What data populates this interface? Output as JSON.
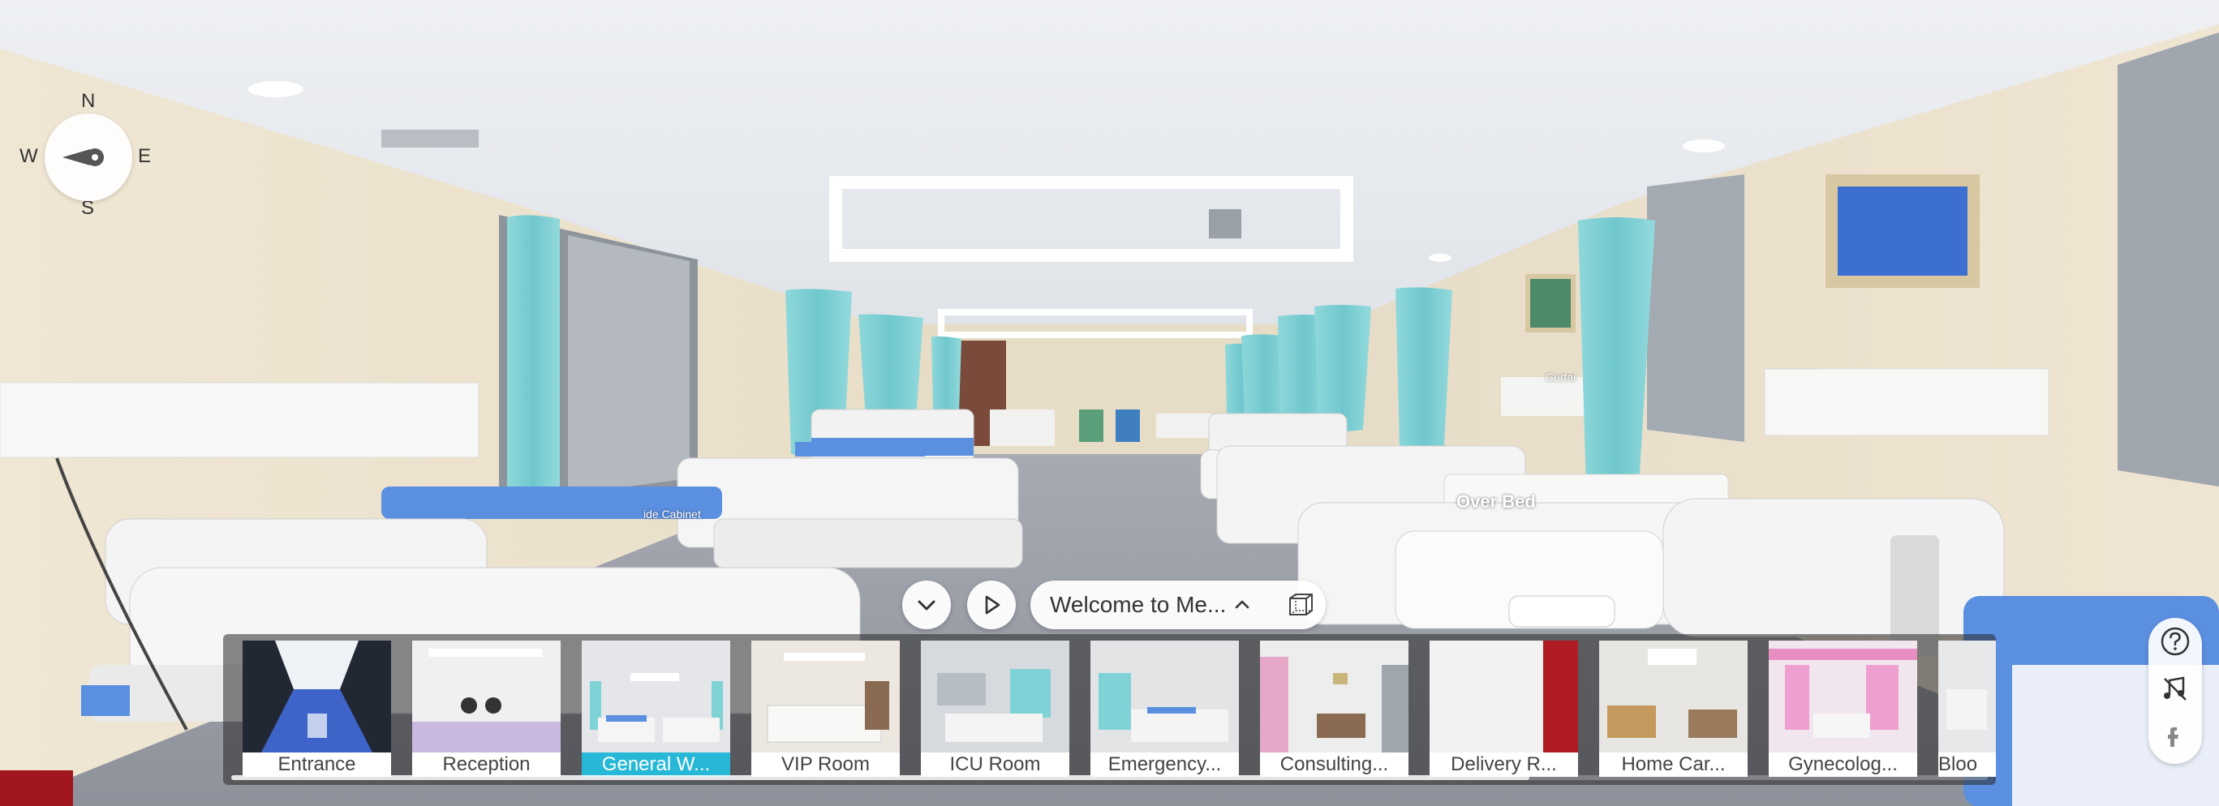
{
  "compass": {
    "north": "N",
    "south": "S",
    "west": "W",
    "east": "E"
  },
  "tour": {
    "title": "Welcome to Me..."
  },
  "hotspots": [
    {
      "label": "ide Cabinet"
    },
    {
      "label": "Over Bed"
    },
    {
      "label": "Curtai"
    }
  ],
  "scenes": [
    {
      "label": "Entrance"
    },
    {
      "label": "Reception"
    },
    {
      "label": "General W...",
      "active": true
    },
    {
      "label": "VIP Room"
    },
    {
      "label": "ICU Room"
    },
    {
      "label": "Emergency..."
    },
    {
      "label": "Consulting..."
    },
    {
      "label": "Delivery R..."
    },
    {
      "label": "Home Car..."
    },
    {
      "label": "Gynecolog..."
    },
    {
      "label": "Bloo"
    }
  ],
  "icons": {
    "collapse": "chevron-down-icon",
    "play": "play-icon",
    "expand": "chevron-up-icon",
    "vr": "vr-cube-icon",
    "help": "help-icon",
    "music": "music-off-icon",
    "share": "share-icon"
  },
  "colors": {
    "accent": "#26b8d6",
    "curtain": "#7fd3d6",
    "bed_top": "#5b8fe0"
  }
}
